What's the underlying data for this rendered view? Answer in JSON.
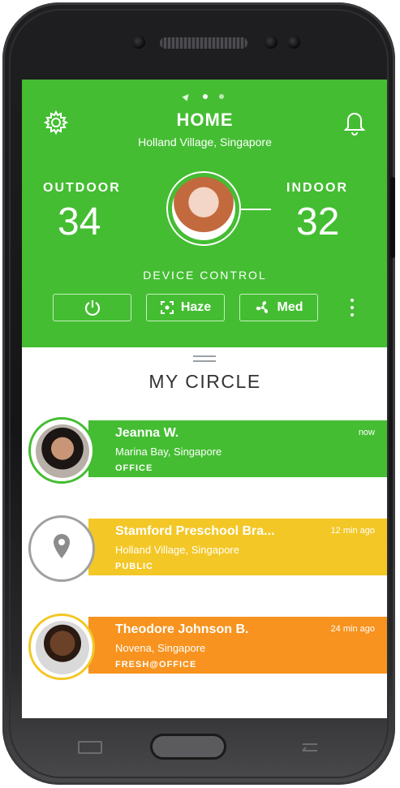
{
  "header": {
    "title": "HOME",
    "location": "Holland Village, Singapore",
    "outdoor_label": "OUTDOOR",
    "outdoor_value": "34",
    "indoor_label": "INDOOR",
    "indoor_value": "32",
    "device_control_label": "DEVICE CONTROL",
    "buttons": {
      "power": "",
      "haze": "Haze",
      "fan": "Med"
    },
    "page_indicator": {
      "pages": 2,
      "active_index": 0
    }
  },
  "circle": {
    "title": "MY CIRCLE",
    "items": [
      {
        "name": "Jeanna W.",
        "location": "Marina Bay, Singapore",
        "tag": "OFFICE",
        "time": "now",
        "color": "#44bd32"
      },
      {
        "name": "Stamford Preschool Bra...",
        "location": "Holland Village, Singapore",
        "tag": "PUBLIC",
        "time": "12 min ago",
        "color": "#f3c726"
      },
      {
        "name": "Theodore Johnson B.",
        "location": "Novena, Singapore",
        "tag": "FRESH@OFFICE",
        "time": "24 min ago",
        "color": "#f7931e"
      }
    ]
  },
  "colors": {
    "header_bg": "#44bd32",
    "green": "#44bd32",
    "yellow": "#f3c726",
    "orange": "#f7931e"
  },
  "icons": {
    "settings": "gear-icon",
    "notifications": "bell-icon",
    "power": "power-icon",
    "haze": "haze-icon",
    "fan": "fan-icon",
    "more": "more-vertical-icon",
    "location": "map-pin-icon"
  }
}
